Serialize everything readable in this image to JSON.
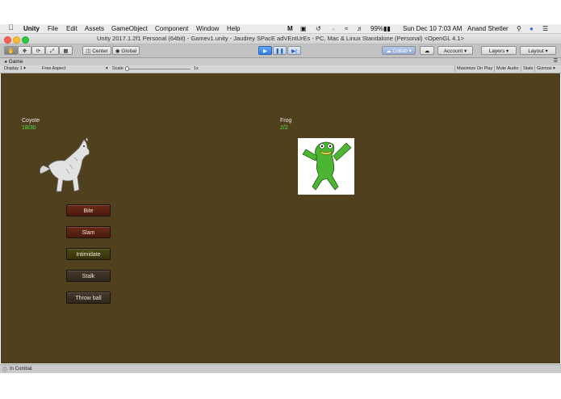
{
  "menubar": {
    "app": "Unity",
    "items": [
      "File",
      "Edit",
      "Assets",
      "GameObject",
      "Component",
      "Window",
      "Help"
    ],
    "battery": "99%",
    "datetime": "Sun Dec 10  7:03 AM",
    "user": "Anand Shetler"
  },
  "window": {
    "title": "Unity 2017.1.2f1 Personal (64bit) - Gamev1.unity - Jaudrey SPacE adVEntUrEs - PC, Mac & Linux Standalone (Personal) <OpenGL 4.1>"
  },
  "toolbar": {
    "pivot": "Center",
    "space": "Global",
    "collab": "Collab",
    "account": "Account",
    "layers": "Layers",
    "layout": "Layout"
  },
  "game_tab": {
    "label": "Game",
    "display": "Display 1",
    "aspect": "Free Aspect",
    "scale_label": "Scale",
    "scale_value": "1x",
    "maximize": "Maximize On Play",
    "mute": "Mute Audio",
    "stats": "Stats",
    "gizmos": "Gizmos"
  },
  "game": {
    "player": {
      "name": "Coyote",
      "hp": "18/30"
    },
    "enemy": {
      "name": "Frog",
      "hp": "2/2"
    },
    "actions": [
      "Bite",
      "Slam",
      "Intimidate",
      "Stalk",
      "Throw ball"
    ],
    "colors": {
      "background": "#51401e",
      "hp": "#4ee54e"
    }
  },
  "status": {
    "text": "In Combat"
  }
}
